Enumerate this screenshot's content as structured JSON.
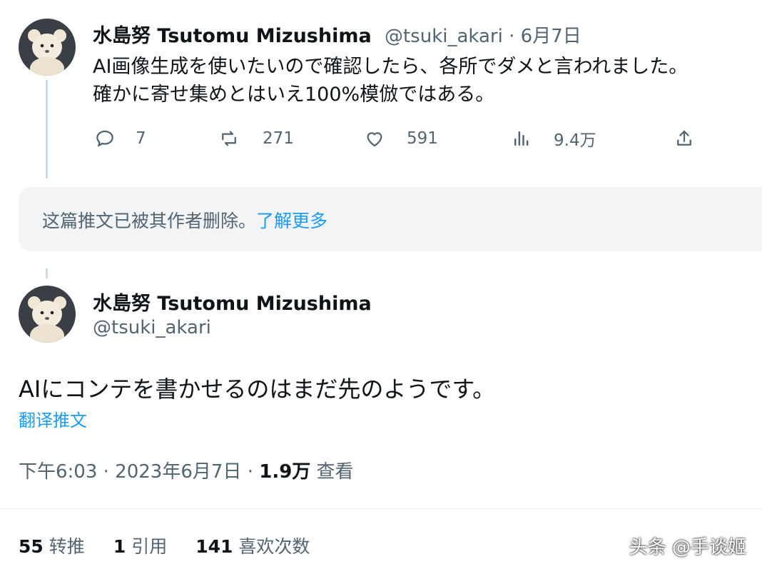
{
  "reply_tweet": {
    "author_name": "水島努 Tsutomu Mizushima",
    "handle": "@tsuki_akari",
    "separator": " · ",
    "date": "6月7日",
    "text_line1": "AI画像生成を使いたいので確認したら、各所でダメと言われました。",
    "text_line2": "確かに寄せ集めとはいえ100%模倣ではある。",
    "actions": {
      "reply_count": "7",
      "retweet_count": "271",
      "like_count": "591",
      "views_count": "9.4万"
    }
  },
  "deleted_notice": {
    "text": "这篇推文已被其作者删除。",
    "link": "了解更多"
  },
  "main_tweet": {
    "author_name": "水島努 Tsutomu Mizushima",
    "handle": "@tsuki_akari",
    "text": "AIにコンテを書かせるのはまだ先のようです。",
    "translate_label": "翻译推文",
    "time": "下午6:03 · 2023年6月7日 · ",
    "views_value": "1.9万",
    "views_label": " 查看"
  },
  "stats": {
    "retweets_value": "55",
    "retweets_label": "转推",
    "quotes_value": "1",
    "quotes_label": "引用",
    "likes_value": "141",
    "likes_label": "喜欢次数"
  },
  "watermark": "头条 @手谈姬",
  "colors": {
    "link": "#1d9bf0",
    "muted": "#536471",
    "text": "#0f1419"
  },
  "icons": [
    "reply-icon",
    "retweet-icon",
    "like-icon",
    "views-icon",
    "share-icon"
  ]
}
